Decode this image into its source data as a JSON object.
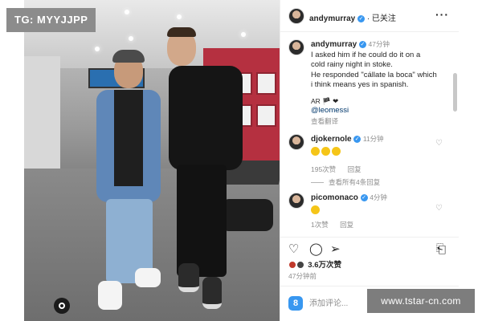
{
  "watermark_top": "TG: MYYJJPP",
  "watermark_bottom": "www.tstar-cn.com",
  "post": {
    "author": "andymurray",
    "follow_status": "· 已关注",
    "more_icon": "more-horizontal-icon"
  },
  "comments": [
    {
      "user": "andymurray",
      "time": "47分钟",
      "lines": [
        "I asked him if he could do it on a",
        "cold rainy night in stoke.",
        "He responded \"cállate la boca\" which",
        "i think means yes in spanish."
      ],
      "flags": "AR 🏴 ❤",
      "mention": "@leomessi",
      "translate": "查看翻译"
    },
    {
      "user": "djokernole",
      "time": "11分钟",
      "likes": "195次赞",
      "reply": "回复",
      "view_replies": "查看所有4条回复"
    },
    {
      "user": "picomonaco",
      "time": "4分钟",
      "likes": "1次赞",
      "reply": "回复"
    }
  ],
  "like_count": "3.6万次赞",
  "post_time": "47分钟前",
  "compose_placeholder": "添加评论..."
}
